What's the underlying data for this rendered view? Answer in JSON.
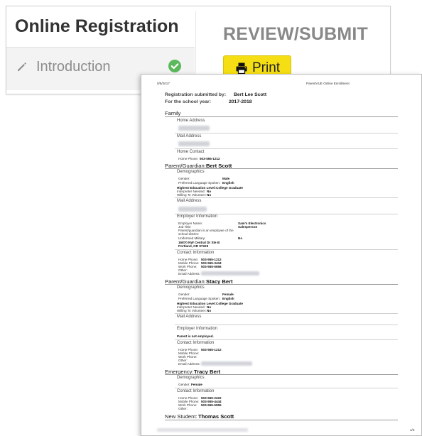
{
  "app": {
    "title": "Online Registration",
    "nav_item": "Introduction",
    "section_title": "REVIEW/SUBMIT",
    "print_label": "Print",
    "accent_yellow": "#f5de13",
    "check_green": "#5cb85c"
  },
  "doc": {
    "date": "0/8/2017",
    "header_title": "ParentVUE Online Enrollment",
    "submitted_by_label": "Registration submitted by:",
    "submitted_by": "Bert Lee Scott",
    "school_year_label": "For the school year:",
    "school_year": "2017-2018",
    "family": "Family",
    "home_address": "Home Address",
    "mail_address": "Mail Address",
    "home_contact": "Home Contact",
    "home_phone_label": "Home Phone:",
    "home_phone": "503-555-1212",
    "pg1_label": "Parent/Guardian:",
    "pg1_name": "Bert Scott",
    "demographics": "Demographics",
    "gender_label": "Gender:",
    "pg1_gender": "Male",
    "lang_label": "Preferred Language Spoken:",
    "lang": "English",
    "edu_label": "Highest Education Level:",
    "edu": "College Graduate",
    "interp_label": "Interpreter Needed:",
    "no": "No",
    "volunteer_label": "Willing To Volunteer:",
    "employer_info": "Employer Information",
    "employer_name_label": "Employer Name:",
    "employer_name": "Sam's Electronics",
    "job_title_label": "Job Title:",
    "job_title": "Salesperson",
    "district_emp_label_1": "Parent/guardian is an employee of the",
    "district_emp_label_2": "school district:",
    "uniformed_label": "Uniformed Military:",
    "emp_addr_1": "16870 NW Central Dr Ste B",
    "emp_addr_2": "Portland, OR 97229",
    "contact_info": "Contact Information",
    "mobile_phone_label": "Mobile Phone:",
    "work_phone_label": "Work Phone:",
    "other_label": "Other:",
    "email_label": "Email Address:",
    "pg1_home_phone": "503-555-1212",
    "pg1_mobile": "503-555-3434",
    "pg1_work": "503-555-5656",
    "pg2_label": "Parent/Guardian:",
    "pg2_name": "Stacy Bert",
    "pg2_gender": "Female",
    "parent_not_employed": "Parent is not employed.",
    "pg2_home_phone": "503-555-1212",
    "emergency_label": "Emergency:",
    "emergency_name": "Tracy Bert",
    "em_gender": "Female",
    "em_home_phone": "503-555-2222",
    "em_mobile": "503-555-4444",
    "em_work": "503-555-5555",
    "new_student_label": "New Student:",
    "new_student_name": "Thomas Scott",
    "page_num": "1/3"
  }
}
